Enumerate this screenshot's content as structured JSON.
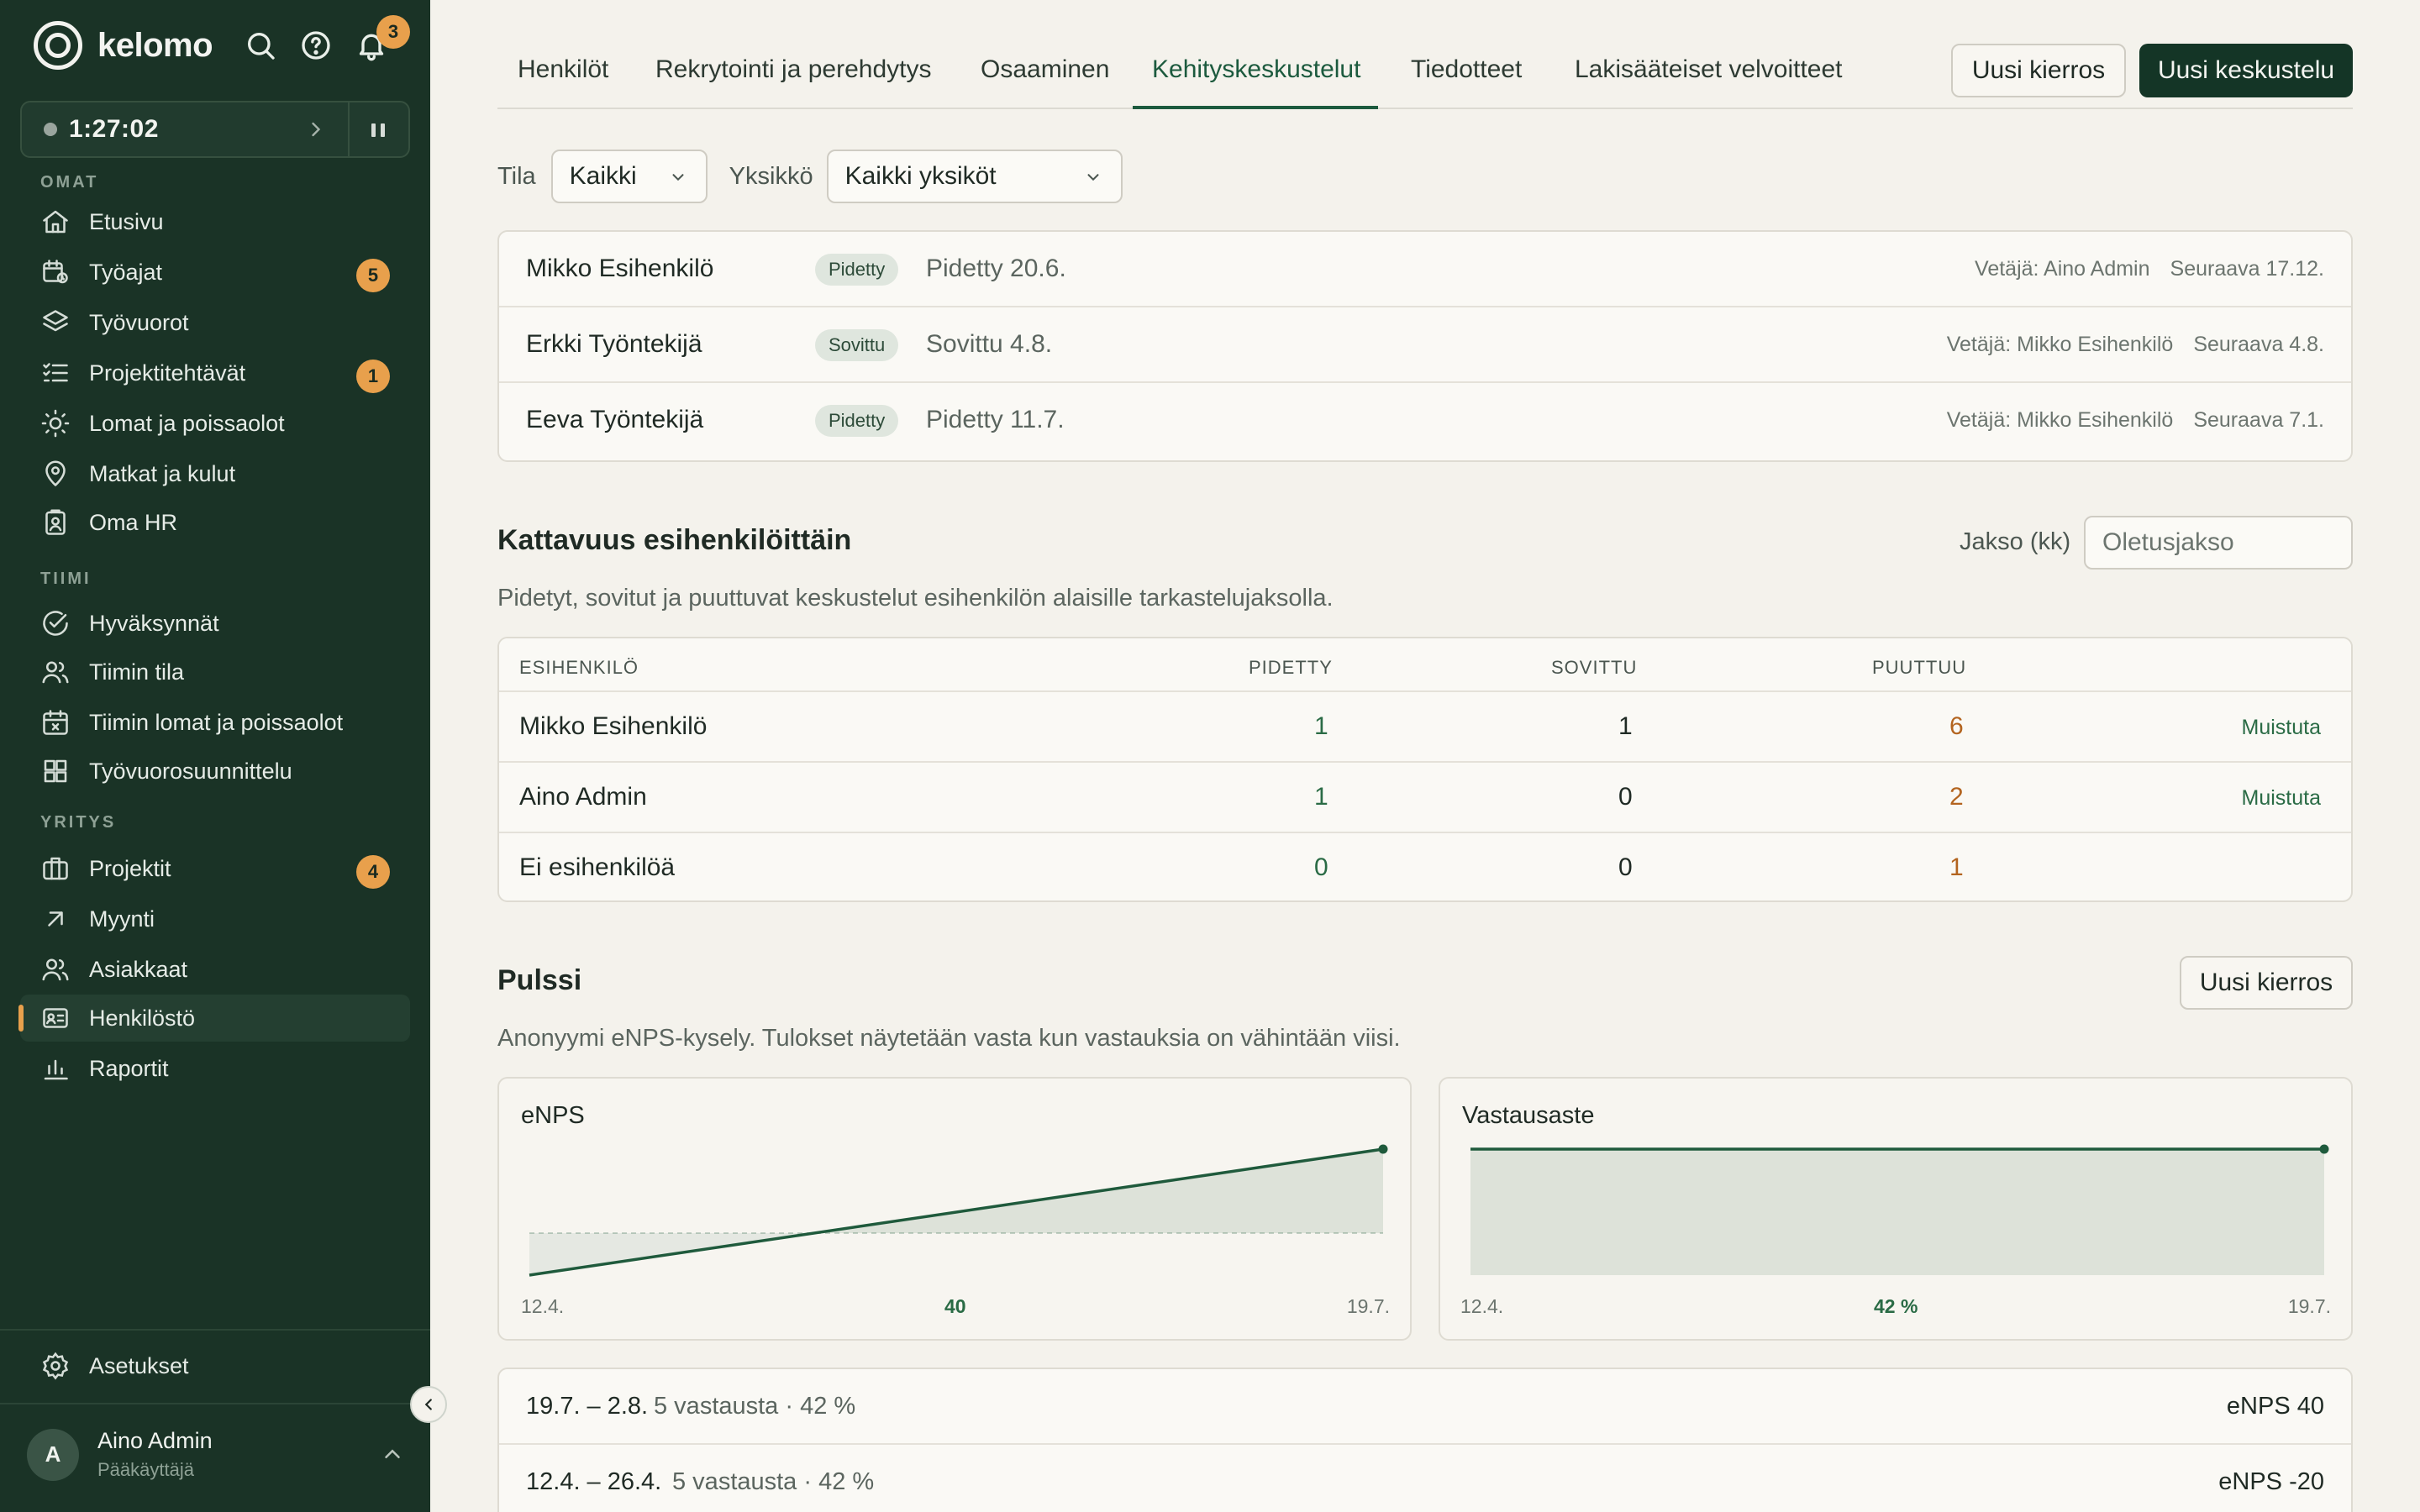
{
  "sidebar": {
    "brand": "kelomo",
    "notifications_count": "3",
    "timer": "1:27:02",
    "sections": {
      "omat": "OMAT",
      "tiimi": "TIIMI",
      "yritys": "YRITYS"
    },
    "items": [
      {
        "label": "Etusivu",
        "icon": "home-icon"
      },
      {
        "label": "Työajat",
        "icon": "calendar-clock-icon",
        "badge": "5"
      },
      {
        "label": "Työvuorot",
        "icon": "layers-icon"
      },
      {
        "label": "Projektitehtävät",
        "icon": "checklist-icon",
        "badge": "1"
      },
      {
        "label": "Lomat ja poissaolot",
        "icon": "sun-icon"
      },
      {
        "label": "Matkat ja kulut",
        "icon": "map-pin-icon"
      },
      {
        "label": "Oma HR",
        "icon": "clipboard-user-icon"
      },
      {
        "label": "Hyväksynnät",
        "icon": "check-circle-icon"
      },
      {
        "label": "Tiimin tila",
        "icon": "users-icon"
      },
      {
        "label": "Tiimin lomat ja poissaolot",
        "icon": "calendar-x-icon"
      },
      {
        "label": "Työvuorosuunnittelu",
        "icon": "grid-icon"
      },
      {
        "label": "Projektit",
        "icon": "briefcase-icon",
        "badge": "4"
      },
      {
        "label": "Myynti",
        "icon": "arrow-up-right-icon"
      },
      {
        "label": "Asiakkaat",
        "icon": "users-icon"
      },
      {
        "label": "Henkilöstö",
        "icon": "id-card-icon",
        "active": true
      },
      {
        "label": "Raportit",
        "icon": "bar-chart-icon"
      }
    ],
    "settings_label": "Asetukset",
    "user": {
      "initial": "A",
      "name": "Aino Admin",
      "role": "Pääkäyttäjä"
    }
  },
  "tabs": [
    {
      "label": "Henkilöt"
    },
    {
      "label": "Rekrytointi ja perehdytys"
    },
    {
      "label": "Osaaminen"
    },
    {
      "label": "Kehityskeskustelut",
      "active": true
    },
    {
      "label": "Tiedotteet"
    },
    {
      "label": "Lakisääteiset velvoitteet"
    }
  ],
  "actions": {
    "new_round": "Uusi kierros",
    "new_conversation": "Uusi keskustelu"
  },
  "filters": {
    "status_label": "Tila",
    "status_value": "Kaikki",
    "unit_label": "Yksikkö",
    "unit_value": "Kaikki yksiköt"
  },
  "conversations": [
    {
      "name": "Mikko Esihenkilö",
      "badge": "Pidetty",
      "status": "Pidetty 20.6.",
      "leader": "Vetäjä: Aino Admin",
      "next": "Seuraava 17.12."
    },
    {
      "name": "Erkki Työntekijä",
      "badge": "Sovittu",
      "status": "Sovittu 4.8.",
      "leader": "Vetäjä: Mikko Esihenkilö",
      "next": "Seuraava 4.8."
    },
    {
      "name": "Eeva Työntekijä",
      "badge": "Pidetty",
      "status": "Pidetty 11.7.",
      "leader": "Vetäjä: Mikko Esihenkilö",
      "next": "Seuraava 7.1."
    }
  ],
  "coverage": {
    "title": "Kattavuus esihenkilöittäin",
    "period_label": "Jakso (kk)",
    "period_placeholder": "Oletusjakso",
    "description": "Pidetyt, sovitut ja puuttuvat keskustelut esihenkilön alaisille tarkastelujaksolla.",
    "headers": {
      "manager": "ESIHENKILÖ",
      "held": "PIDETTY",
      "agreed": "SOVITTU",
      "missing": "PUUTTUU"
    },
    "rows": [
      {
        "manager": "Mikko Esihenkilö",
        "held": "1",
        "agreed": "1",
        "missing": "6",
        "action": "Muistuta"
      },
      {
        "manager": "Aino Admin",
        "held": "1",
        "agreed": "0",
        "missing": "2",
        "action": "Muistuta"
      },
      {
        "manager": "Ei esihenkilöä",
        "held": "0",
        "agreed": "0",
        "missing": "1",
        "action": ""
      }
    ]
  },
  "pulse": {
    "title": "Pulssi",
    "new_round": "Uusi kierros",
    "description": "Anonyymi eNPS-kysely. Tulokset näytetään vasta kun vastauksia on vähintään viisi."
  },
  "chart_data": [
    {
      "type": "area",
      "title": "eNPS",
      "x": [
        "12.4.",
        "19.7."
      ],
      "values": [
        -20,
        40
      ],
      "start_label": "12.4.",
      "end_label": "19.7.",
      "current_label": "40",
      "ylim": [
        -100,
        100
      ],
      "color": "#1f5a3c"
    },
    {
      "type": "area",
      "title": "Vastausaste",
      "x": [
        "12.4.",
        "19.7."
      ],
      "values": [
        42,
        42
      ],
      "start_label": "12.4.",
      "end_label": "19.7.",
      "current_label": "42 %",
      "color": "#1f5a3c"
    }
  ],
  "rounds": [
    {
      "dates": "19.7. – 2.8.",
      "info": "5 vastausta · 42 %",
      "score": "eNPS 40"
    },
    {
      "dates": "12.4. – 26.4.",
      "info": "5 vastausta · 42 %",
      "score": "eNPS -20"
    }
  ]
}
